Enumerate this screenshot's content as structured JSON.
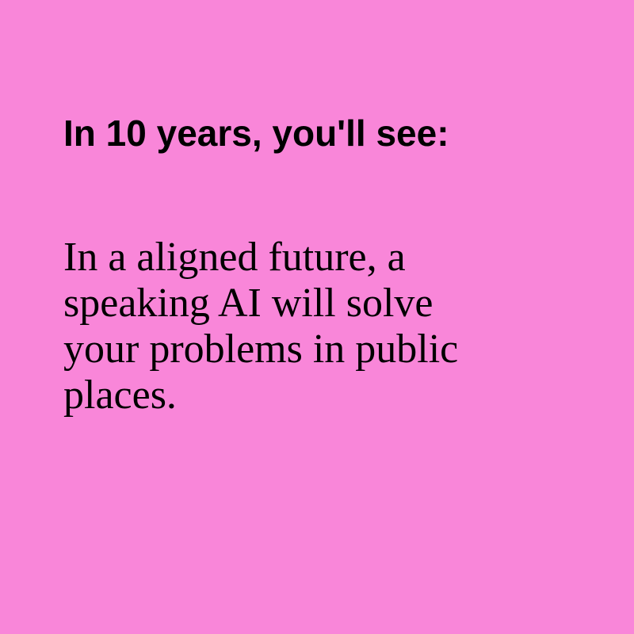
{
  "background_color": "#f986d9",
  "text_color": "#000000",
  "heading": "In 10 years, you'll see:",
  "body_lines": [
    "In a aligned future, a",
    "speaking AI will solve",
    "your problems in public",
    "places."
  ]
}
